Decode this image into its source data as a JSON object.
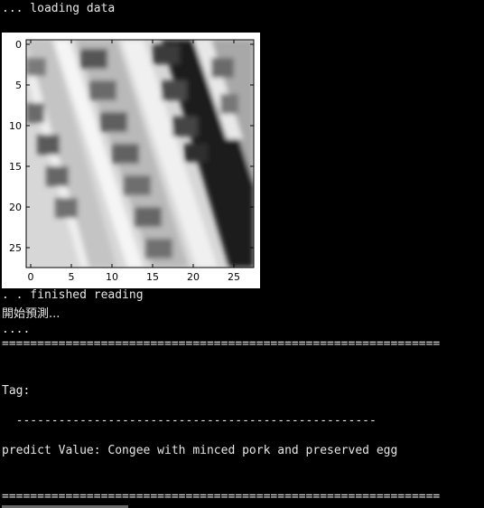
{
  "console": {
    "loading_line": "... loading data",
    "finished_line": ". . finished reading",
    "predict_start": "開始預測...",
    "dots": "....",
    "separator": "==============================================================",
    "tag_label": "Tag:",
    "dashes": "  ---------------------------------------------------",
    "predict_line": "predict Value: Congee with minced pork and preserved egg",
    "separator_bottom": "==============================================================",
    "colors": {
      "background": "#000000",
      "text": "#e6e6e6",
      "partial_top_line": "#d01818"
    }
  },
  "plot": {
    "x_ticks": [
      "0",
      "5",
      "10",
      "15",
      "20",
      "25"
    ],
    "y_ticks": [
      "0",
      "5",
      "10",
      "15",
      "20",
      "25"
    ],
    "colormap": "grayscale"
  }
}
